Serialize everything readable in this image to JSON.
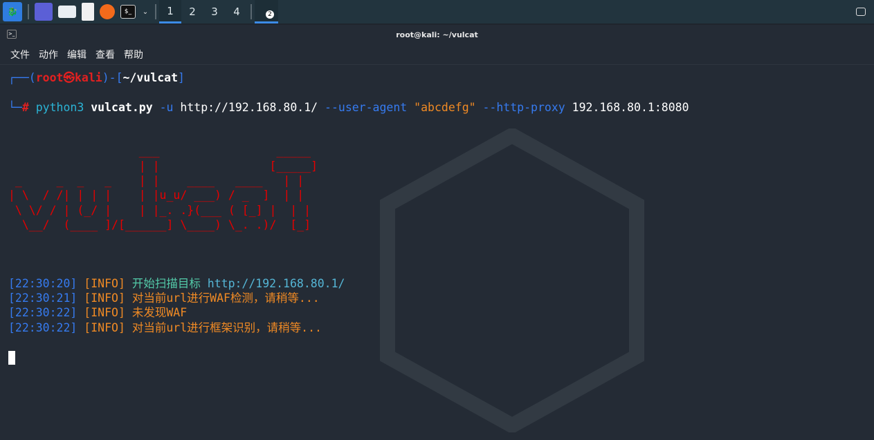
{
  "taskbar": {
    "workspaces": [
      "1",
      "2",
      "3",
      "4"
    ],
    "active_workspace": "1",
    "terminal_badge": "2"
  },
  "window": {
    "title": "root@kali: ~/vulcat"
  },
  "menu": [
    "文件",
    "动作",
    "编辑",
    "查看",
    "帮助"
  ],
  "prompt": {
    "open": "┌──(",
    "user": "root㉿kali",
    "mid": ")-[",
    "path": "~/vulcat",
    "close": "]",
    "corner": "└─",
    "hash": "#",
    "cmd": "python3",
    "script": "vulcat.py",
    "args": [
      {
        "t": " -u ",
        "c": "blue"
      },
      {
        "t": "http://192.168.80.1/ ",
        "c": "white"
      },
      {
        "t": "--user-agent ",
        "c": "blue"
      },
      {
        "t": "\"abcdefg\" ",
        "c": "orange"
      },
      {
        "t": "--http-proxy ",
        "c": "blue"
      },
      {
        "t": "192.168.80.1:8080",
        "c": "white"
      }
    ]
  },
  "banner": "                   ___                 _____\n                   | |                [_____]\n _     _  _   _    | |    ____   ____   | |\n| \\  / /| | | |    | |u_u/ ___) / _  ]  | |\n \\ \\/ / | (_/ |    | |_. .}(___ ( [_] |  | |\n  \\__/  (____ ]/[______] \\____) \\_. .)/  [_]",
  "logs": [
    {
      "time": "[22:30:20]",
      "level": "[INFO]",
      "msg": "开始扫描目标 ",
      "extra": "http://192.168.80.1/",
      "color": "grn"
    },
    {
      "time": "[22:30:21]",
      "level": "[INFO]",
      "msg": "对当前url进行WAF检测，请稍等...",
      "extra": "",
      "color": "orange"
    },
    {
      "time": "[22:30:22]",
      "level": "[INFO]",
      "msg": "未发现WAF",
      "extra": "",
      "color": "orange"
    },
    {
      "time": "[22:30:22]",
      "level": "[INFO]",
      "msg": "对当前url进行框架识别，请稍等...",
      "extra": "",
      "color": "orange"
    }
  ]
}
